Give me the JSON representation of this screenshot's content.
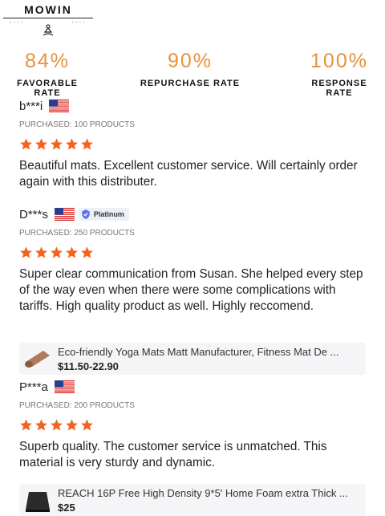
{
  "brand": {
    "name": "MOWIN"
  },
  "stats": [
    {
      "value": "84%",
      "label": "FAVORABLE RATE"
    },
    {
      "value": "90%",
      "label": "REPURCHASE RATE"
    },
    {
      "value": "100%",
      "label": "RESPONSE RATE"
    }
  ],
  "colors": {
    "accent": "#e8913c",
    "star": "#f5621c",
    "badge_bg": "#eef0f8"
  },
  "reviews": [
    {
      "reviewer": "b***i",
      "flag": "us-flag-icon",
      "purchased": "PURCHASED: 100 PRODUCTS",
      "rating": 5,
      "comment": "Beautiful mats. Excellent customer service. Will certainly order again with this distributer."
    },
    {
      "reviewer": "D***s",
      "flag": "us-flag-icon",
      "badge": "Platinum",
      "purchased": "PURCHASED: 250 PRODUCTS",
      "rating": 5,
      "comment": "Super clear communication from Susan. She helped every step of the way even when there were some complications with tariffs. High quality product as well. Highly reccomend.",
      "product": {
        "title": "Eco-friendly Yoga Mats Matt Manufacturer, Fitness Mat De ...",
        "price": "$11.50-22.90"
      }
    },
    {
      "reviewer": "P***a",
      "flag": "us-flag-icon",
      "purchased": "PURCHASED: 200 PRODUCTS",
      "rating": 5,
      "comment": "Superb quality. The customer service is unmatched. This material is very sturdy and dynamic.",
      "product": {
        "title": "REACH 16P Free High Density 9*5' Home Foam extra Thick ...",
        "price": "$25"
      }
    }
  ]
}
